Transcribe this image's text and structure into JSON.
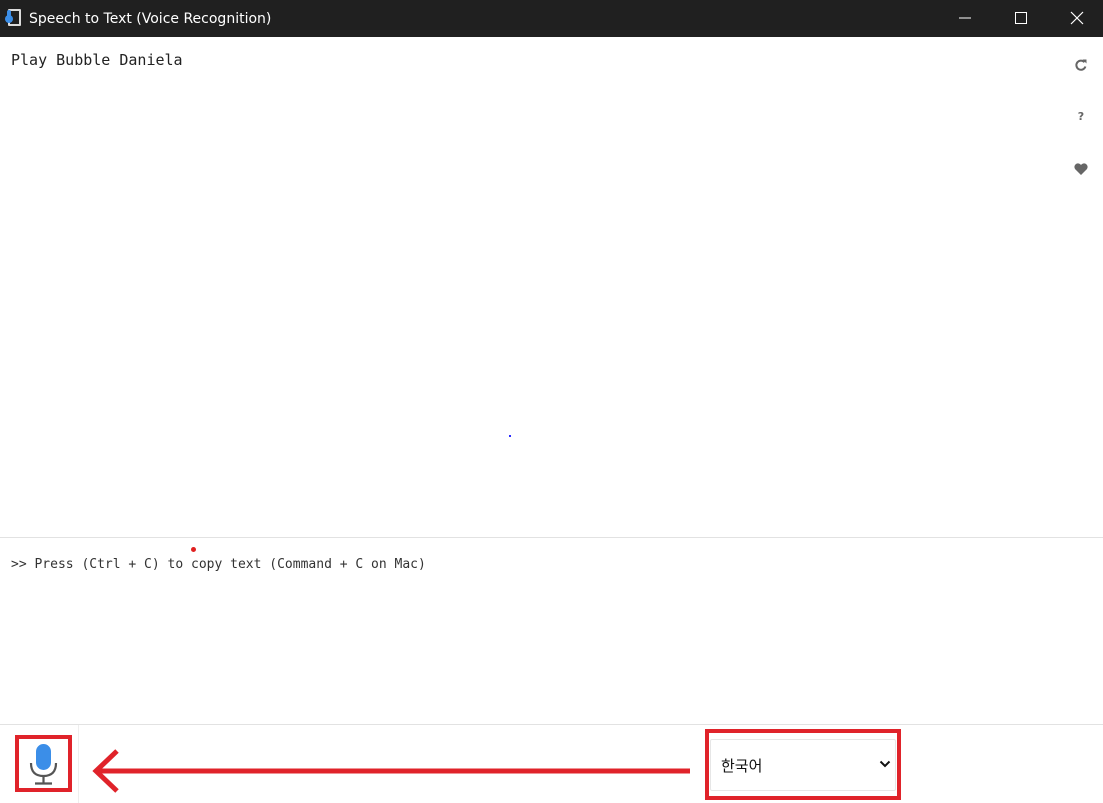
{
  "window": {
    "title": "Speech to Text (Voice Recognition)"
  },
  "transcript": {
    "text": "Play Bubble Daniela"
  },
  "hint": {
    "text": ">> Press (Ctrl + C) to copy text (Command + C on Mac)"
  },
  "side_icons": [
    "refresh-icon",
    "help-icon",
    "heart-icon"
  ],
  "side_icon_glyphs": {
    "help": "?"
  },
  "language": {
    "selected": "한국어"
  },
  "colors": {
    "titlebar": "#202020",
    "highlight": "#e0232a",
    "mic_blue": "#3b8ee8"
  }
}
